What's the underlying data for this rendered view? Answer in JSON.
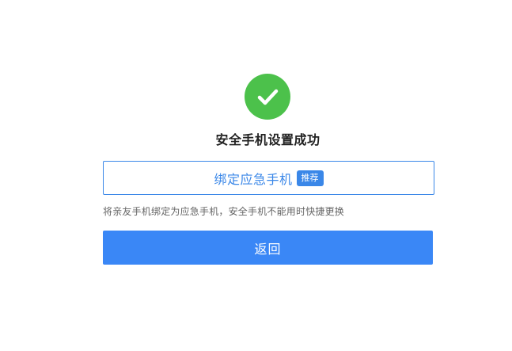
{
  "icons": {
    "success": "check-circle-icon"
  },
  "colors": {
    "success_green": "#4cc14b",
    "accent_blue": "#3a87e8",
    "primary_button": "#3a87f6"
  },
  "title": "安全手机设置成功",
  "bind_button": {
    "label": "绑定应急手机",
    "badge": "推荐"
  },
  "hint": "将亲友手机绑定为应急手机，安全手机不能用时快捷更换",
  "back_button": {
    "label": "返回"
  }
}
